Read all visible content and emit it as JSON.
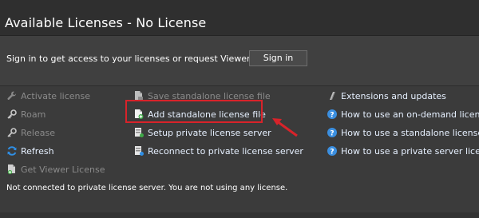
{
  "header": {
    "title": "Available Licenses - No License"
  },
  "signin": {
    "prompt": "Sign in to get access to your licenses or request Viewer License",
    "button_label": "Sign in"
  },
  "column1": {
    "activate": "Activate license",
    "roam": "Roam",
    "release": "Release",
    "refresh": "Refresh",
    "viewer": "Get Viewer License"
  },
  "column2": {
    "save": "Save standalone license file",
    "add": "Add standalone license file",
    "setup": "Setup private license server",
    "reconnect": "Reconnect to private license server"
  },
  "column3": {
    "extensions": "Extensions and updates",
    "howto_ondemand": "How to use an on-demand license",
    "howto_standalone": "How to use a standalone license",
    "howto_private": "How to use a private server license"
  },
  "status": {
    "text": "Not connected to private license server. You are not using any license."
  },
  "colors": {
    "highlight": "#d8232a",
    "help_icon": "#3b8fe0",
    "refresh_icon": "#2f8fe6"
  }
}
